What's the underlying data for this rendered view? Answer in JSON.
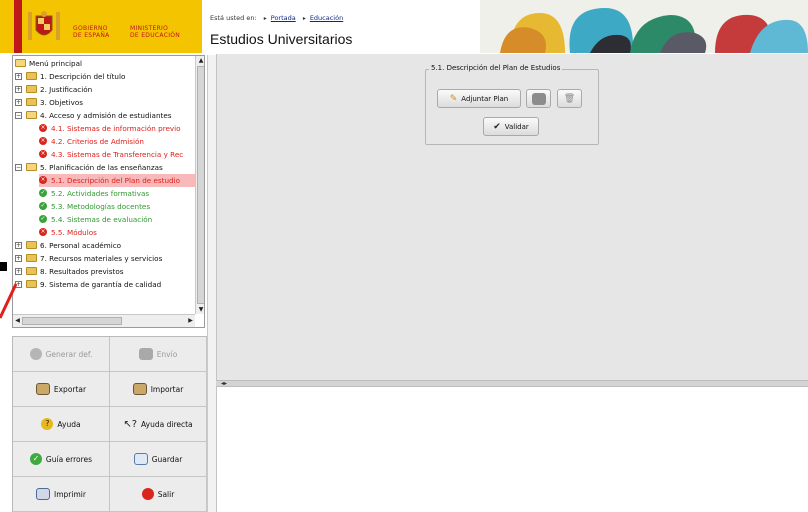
{
  "header": {
    "gov_line1": "GOBIERNO",
    "gov_line2": "DE ESPAÑA",
    "min_line1": "MINISTERIO",
    "min_line2": "DE EDUCACIÓN",
    "breadcrumb_prefix": "Está usted en:",
    "breadcrumb_links": [
      "Portada",
      "Educación"
    ],
    "page_title": "Estudios Universitarios"
  },
  "tree": {
    "root": "Menú principal",
    "items": [
      {
        "label": "1. Descripción del título",
        "type": "folder",
        "level": 1
      },
      {
        "label": "2. Justificación",
        "type": "folder",
        "level": 1
      },
      {
        "label": "3. Objetivos",
        "type": "folder",
        "level": 1
      },
      {
        "label": "4. Acceso y admisión de estudiantes",
        "type": "folder-open",
        "level": 1
      },
      {
        "label": "4.1. Sistemas de información previo",
        "type": "error",
        "level": 2
      },
      {
        "label": "4.2. Criterios de Admisión",
        "type": "error",
        "level": 2
      },
      {
        "label": "4.3. Sistemas de Transferencia y Rec",
        "type": "error",
        "level": 2
      },
      {
        "label": "5. Planificación de las enseñanzas",
        "type": "folder-open",
        "level": 1
      },
      {
        "label": "5.1. Descripción del Plan de estudio",
        "type": "error-selected",
        "level": 2
      },
      {
        "label": "5.2. Actividades formativas",
        "type": "ok",
        "level": 2
      },
      {
        "label": "5.3. Metodologías docentes",
        "type": "ok",
        "level": 2
      },
      {
        "label": "5.4. Sistemas de evaluación",
        "type": "ok",
        "level": 2
      },
      {
        "label": "5.5. Módulos",
        "type": "error",
        "level": 2
      },
      {
        "label": "6. Personal académico",
        "type": "folder",
        "level": 1
      },
      {
        "label": "7. Recursos materiales y servicios",
        "type": "folder",
        "level": 1
      },
      {
        "label": "8. Resultados previstos",
        "type": "folder",
        "level": 1
      },
      {
        "label": "9. Sistema de garantía de calidad",
        "type": "folder",
        "level": 1
      }
    ]
  },
  "actions": {
    "generar": "Generar def.",
    "envio": "Envío",
    "exportar": "Exportar",
    "importar": "Importar",
    "ayuda": "Ayuda",
    "ayuda_directa": "Ayuda directa",
    "guia_errores": "Guía errores",
    "guardar": "Guardar",
    "imprimir": "Imprimir",
    "salir": "Salir"
  },
  "plan": {
    "legend": "5.1. Descripción del Plan de Estudios",
    "adjuntar": "Adjuntar Plan",
    "validar": "Validar"
  },
  "colors": {
    "brand_yellow": "#f5c400",
    "brand_red": "#c0171b",
    "error_red": "#e0201b",
    "ok_green": "#2e9a2e",
    "selected_bg": "#f7b9b9"
  }
}
